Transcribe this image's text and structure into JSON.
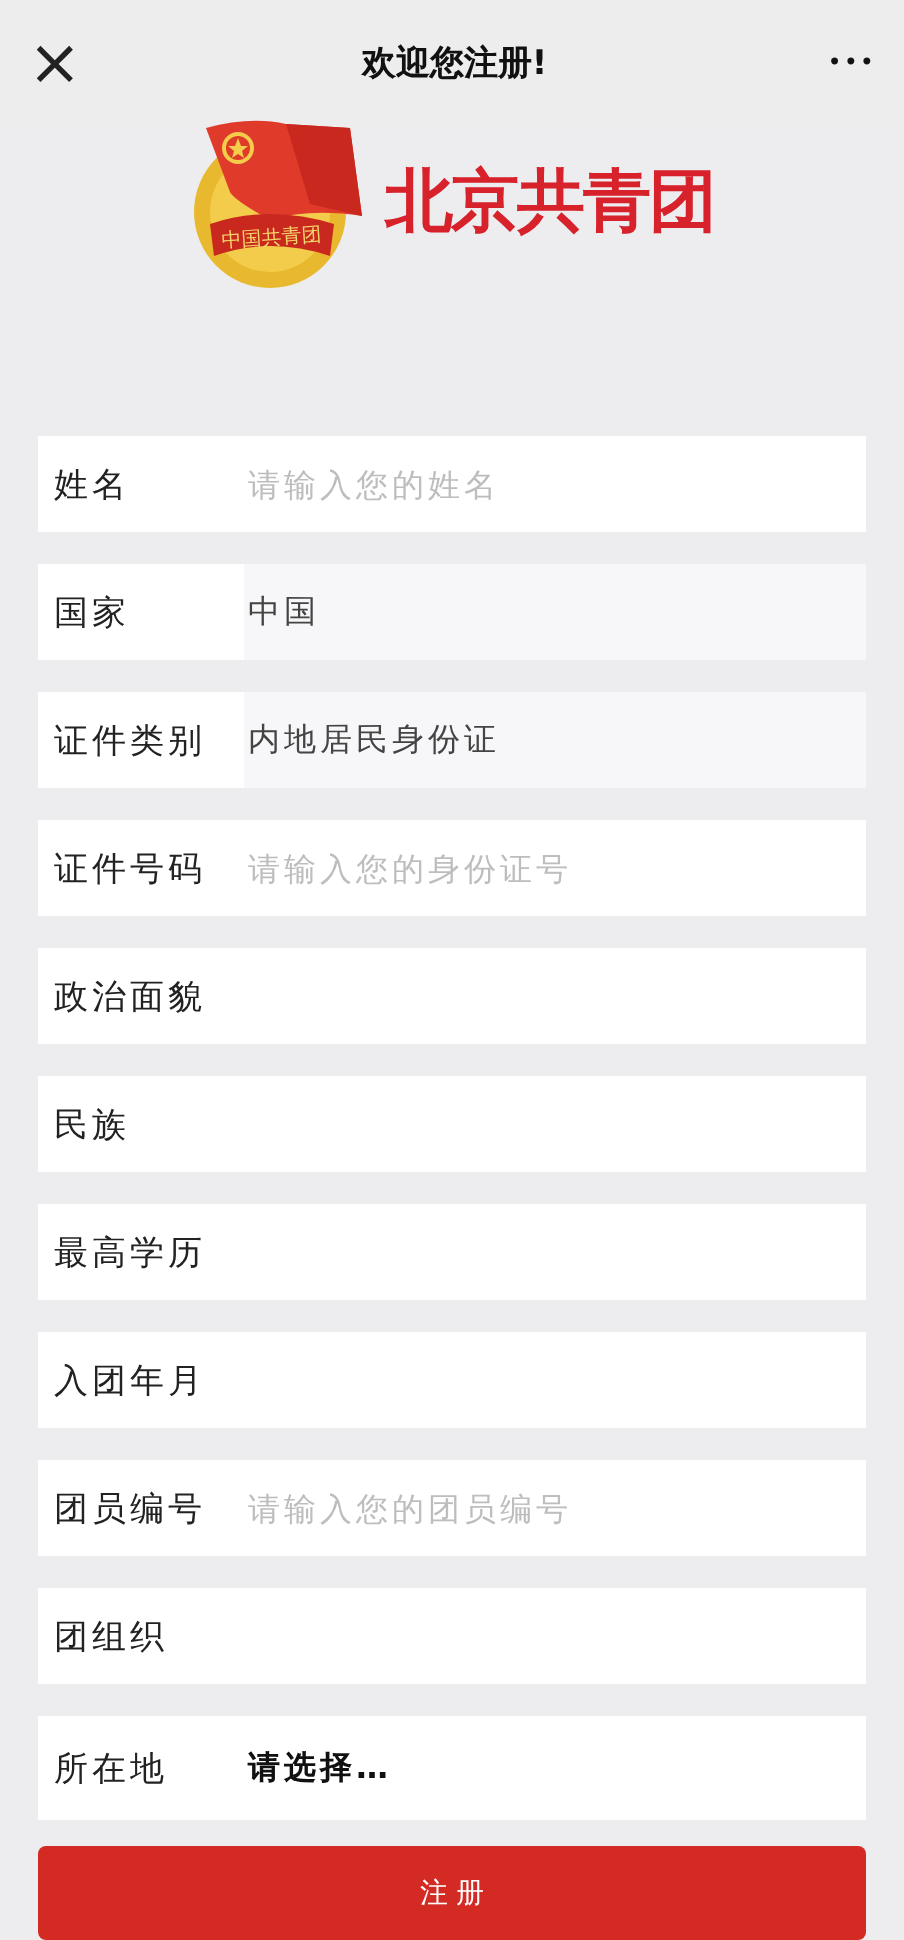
{
  "header": {
    "close_icon": "×",
    "title": "欢迎您注册!",
    "more_icon": "•••"
  },
  "logo": {
    "emblem_text": "中国共青团",
    "brand": "北京共青团"
  },
  "fields": [
    {
      "kind": "input",
      "label": "姓名",
      "placeholder": "请输入您的姓名"
    },
    {
      "kind": "readonly",
      "label": "国家",
      "value": "中国"
    },
    {
      "kind": "readonly",
      "label": "证件类别",
      "value": "内地居民身份证"
    },
    {
      "kind": "input",
      "label": "证件号码",
      "placeholder": "请输入您的身份证号"
    },
    {
      "kind": "select",
      "label": "政治面貌"
    },
    {
      "kind": "select",
      "label": "民族"
    },
    {
      "kind": "select",
      "label": "最高学历"
    },
    {
      "kind": "select",
      "label": "入团年月"
    },
    {
      "kind": "input",
      "label": "团员编号",
      "placeholder": "请输入您的团员编号"
    },
    {
      "kind": "select",
      "label": "团组织"
    },
    {
      "kind": "picker",
      "label": "所在地",
      "value": "请选择…"
    }
  ],
  "submit": "注 册"
}
